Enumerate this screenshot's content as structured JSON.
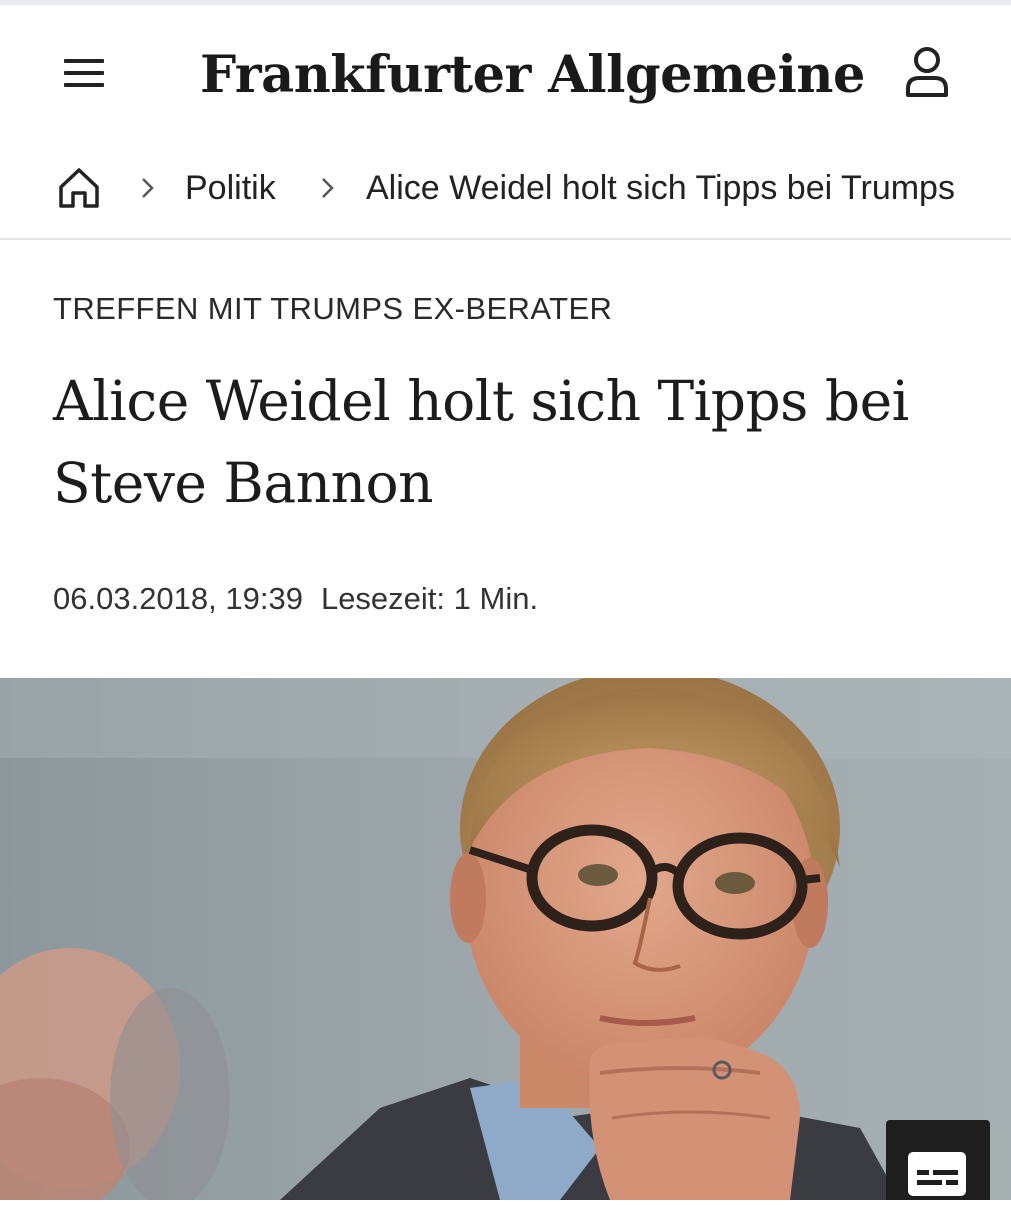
{
  "header": {
    "logo_text": "Frankfurter Allgemeine",
    "menu_icon": "hamburger-menu-icon",
    "user_icon": "user-account-icon"
  },
  "breadcrumb": {
    "home_icon": "home-icon",
    "separator_icon": "chevron-right-icon",
    "section": "Politik",
    "current": "Alice Weidel holt sich Tipps bei Trumps"
  },
  "article": {
    "kicker": "TREFFEN MIT TRUMPS EX-BERATER",
    "headline": "Alice Weidel holt sich Tipps bei Steve Bannon",
    "date": "06.03.2018, 19:39",
    "reading_time": "Lesezeit: 1 Min."
  },
  "hero_image": {
    "caption_toggle_icon": "caption-subtitles-icon"
  },
  "colors": {
    "background": "#ffffff",
    "text": "#222222",
    "divider": "#e3e3e3",
    "caption_button": "#1e1e1e"
  }
}
